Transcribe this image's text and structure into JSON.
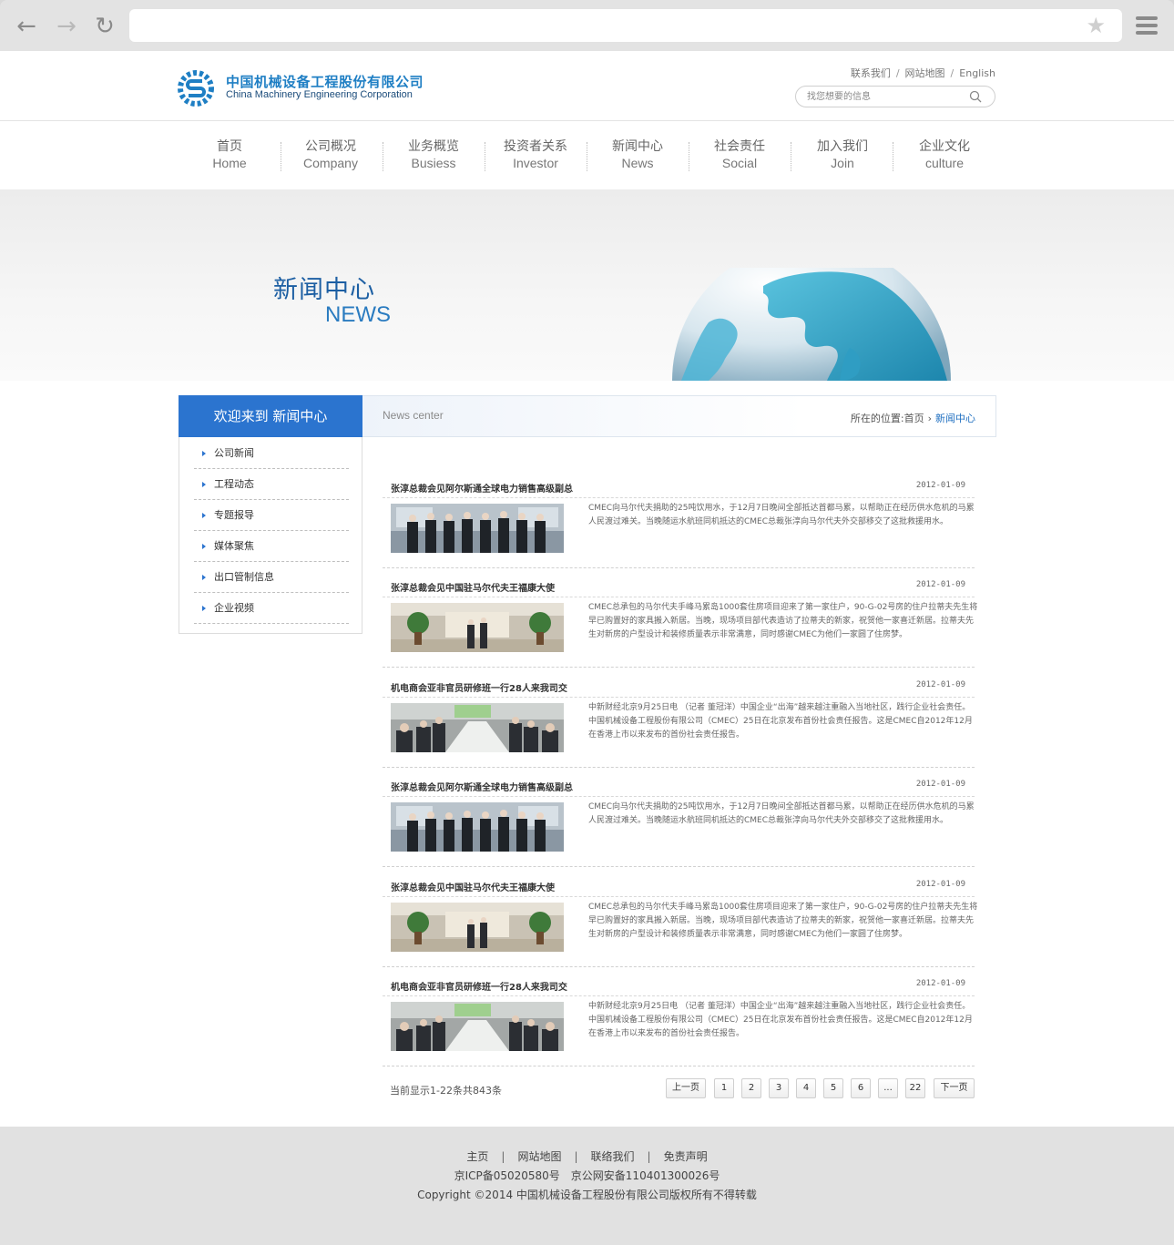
{
  "header": {
    "logo_cn": "中国机械设备工程股份有限公司",
    "logo_en": "China Machinery Engineering Corporation",
    "toplinks": [
      "联系我们",
      "网站地图",
      "English"
    ],
    "search_placeholder": "找您想要的信息"
  },
  "nav": [
    {
      "cn": "首页",
      "en": "Home"
    },
    {
      "cn": "公司概况",
      "en": "Company"
    },
    {
      "cn": "业务概览",
      "en": "Busiess"
    },
    {
      "cn": "投资者关系",
      "en": "Investor"
    },
    {
      "cn": "新闻中心",
      "en": "News"
    },
    {
      "cn": "社会责任",
      "en": "Social"
    },
    {
      "cn": "加入我们",
      "en": "Join"
    },
    {
      "cn": "企业文化",
      "en": "culture"
    }
  ],
  "banner": {
    "title_cn": "新闻中心",
    "title_en": "NEWS"
  },
  "sidebar": {
    "heading": "欢迎来到 新闻中心",
    "items": [
      "公司新闻",
      "工程动态",
      "专题报导",
      "媒体聚焦",
      "出口管制信息",
      "企业视频"
    ]
  },
  "content": {
    "title": "News center",
    "breadcrumb": {
      "prefix": "所在的位置:",
      "home": "首页",
      "current": "新闻中心"
    }
  },
  "news": [
    {
      "title": "张淳总裁会见阿尔斯通全球电力销售高级副总",
      "date": "2012-01-09",
      "photo": "group",
      "desc": "CMEC向马尔代夫捐助的25吨饮用水，于12月7日晚间全部抵达首都马累，以帮助正在经历供水危机的马累人民渡过难关。当晚随运水航班同机抵达的CMEC总裁张淳向马尔代夫外交部移交了这批救援用水。"
    },
    {
      "title": "张淳总裁会见中国驻马尔代夫王福康大使",
      "date": "2012-01-09",
      "photo": "hall",
      "desc": "CMEC总承包的马尔代夫手峰马累岛1000套住房项目迎来了第一家住户，90-G-02号房的住户拉蒂夫先生将早已购置好的家具搬入新居。当晚，现场项目部代表造访了拉蒂夫的新家，祝贺他一家喜迁新居。拉蒂夫先生对新房的户型设计和装修质量表示非常满意，同时感谢CMEC为他们一家圆了住房梦。"
    },
    {
      "title": "机电商会亚非官员研修班一行28人来我司交",
      "date": "2012-01-09",
      "photo": "meeting",
      "desc": "中新财经北京9月25日电 （记者 董冠洋）中国企业“出海”越来越注重融入当地社区，践行企业社会责任。中国机械设备工程股份有限公司（CMEC）25日在北京发布首份社会责任报告。这是CMEC自2012年12月在香港上市以来发布的首份社会责任报告。"
    },
    {
      "title": "张淳总裁会见阿尔斯通全球电力销售高级副总",
      "date": "2012-01-09",
      "photo": "group",
      "desc": "CMEC向马尔代夫捐助的25吨饮用水，于12月7日晚间全部抵达首都马累，以帮助正在经历供水危机的马累人民渡过难关。当晚随运水航班同机抵达的CMEC总裁张淳向马尔代夫外交部移交了这批救援用水。"
    },
    {
      "title": "张淳总裁会见中国驻马尔代夫王福康大使",
      "date": "2012-01-09",
      "photo": "hall",
      "desc": "CMEC总承包的马尔代夫手峰马累岛1000套住房项目迎来了第一家住户，90-G-02号房的住户拉蒂夫先生将早已购置好的家具搬入新居。当晚，现场项目部代表造访了拉蒂夫的新家，祝贺他一家喜迁新居。拉蒂夫先生对新房的户型设计和装修质量表示非常满意，同时感谢CMEC为他们一家圆了住房梦。"
    },
    {
      "title": "机电商会亚非官员研修班一行28人来我司交",
      "date": "2012-01-09",
      "photo": "meeting",
      "desc": "中新财经北京9月25日电 （记者 董冠洋）中国企业“出海”越来越注重融入当地社区，践行企业社会责任。中国机械设备工程股份有限公司（CMEC）25日在北京发布首份社会责任报告。这是CMEC自2012年12月在香港上市以来发布的首份社会责任报告。"
    }
  ],
  "pagination": {
    "info": "当前显示1-22条共843条",
    "prev": "上一页",
    "pages": [
      "1",
      "2",
      "3",
      "4",
      "5",
      "6",
      "...",
      "22"
    ],
    "next": "下一页"
  },
  "footer": {
    "links": [
      "主页",
      "网站地图",
      "联络我们",
      "免责声明"
    ],
    "icp": [
      "京ICP备05020580号",
      "京公网安备110401300026号"
    ],
    "copyright": "Copyright ©2014 中国机械设备工程股份有限公司版权所有不得转载"
  },
  "colors": {
    "brand_blue": "#2b74cf",
    "logo_blue": "#1f7fc4",
    "footer_bg": "#e1e1e1"
  }
}
